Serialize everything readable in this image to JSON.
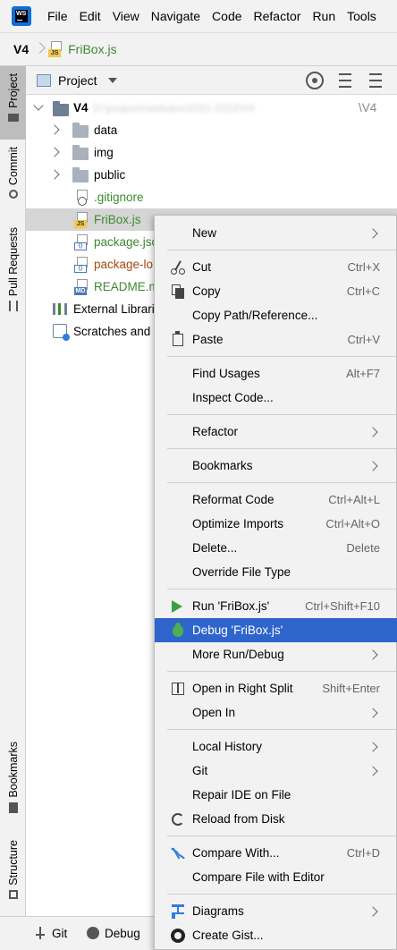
{
  "menubar": {
    "logo_text": "WS",
    "items": [
      "File",
      "Edit",
      "View",
      "Navigate",
      "Code",
      "Refactor",
      "Run",
      "Tools"
    ]
  },
  "breadcrumb": {
    "root": "V4",
    "file": "FriBox.js",
    "file_badge": "JS"
  },
  "left_stripe": {
    "tabs": [
      "Project",
      "Commit",
      "Pull Requests",
      "Bookmarks",
      "Structure"
    ]
  },
  "project_panel": {
    "title": "Project",
    "tree": {
      "root": {
        "name": "V4",
        "path_suffix": "\\V4",
        "path_blurred": "D:\\projects\\webdev\\2021-2022\\V4"
      },
      "items": [
        {
          "label": "data",
          "kind": "folder"
        },
        {
          "label": "img",
          "kind": "folder"
        },
        {
          "label": "public",
          "kind": "folder"
        },
        {
          "label": ".gitignore",
          "kind": "file",
          "badge": "",
          "color": "green"
        },
        {
          "label": "FriBox.js",
          "kind": "file",
          "badge": "JS",
          "color": "green"
        },
        {
          "label": "package.jso",
          "kind": "file",
          "badge": "{}",
          "color": "green"
        },
        {
          "label": "package-lo",
          "kind": "file",
          "badge": "{}",
          "color": "brown"
        },
        {
          "label": "README.m",
          "kind": "file",
          "badge": "MD",
          "color": "green"
        },
        {
          "label": "External Librari",
          "kind": "libs"
        },
        {
          "label": "Scratches and",
          "kind": "scratches"
        }
      ]
    }
  },
  "context_menu": {
    "items": [
      {
        "label": "New",
        "shortcut": "",
        "submenu": true
      },
      {
        "label": "Cut",
        "shortcut": "Ctrl+X"
      },
      {
        "label": "Copy",
        "shortcut": "Ctrl+C"
      },
      {
        "label": "Copy Path/Reference...",
        "shortcut": ""
      },
      {
        "label": "Paste",
        "shortcut": "Ctrl+V"
      },
      {
        "label": "Find Usages",
        "shortcut": "Alt+F7"
      },
      {
        "label": "Inspect Code...",
        "shortcut": ""
      },
      {
        "label": "Refactor",
        "shortcut": "",
        "submenu": true
      },
      {
        "label": "Bookmarks",
        "shortcut": "",
        "submenu": true
      },
      {
        "label": "Reformat Code",
        "shortcut": "Ctrl+Alt+L"
      },
      {
        "label": "Optimize Imports",
        "shortcut": "Ctrl+Alt+O"
      },
      {
        "label": "Delete...",
        "shortcut": "Delete"
      },
      {
        "label": "Override File Type",
        "shortcut": ""
      },
      {
        "label": "Run 'FriBox.js'",
        "shortcut": "Ctrl+Shift+F10"
      },
      {
        "label": "Debug 'FriBox.js'",
        "shortcut": "",
        "highlighted": true
      },
      {
        "label": "More Run/Debug",
        "shortcut": "",
        "submenu": true
      },
      {
        "label": "Open in Right Split",
        "shortcut": "Shift+Enter"
      },
      {
        "label": "Open In",
        "shortcut": "",
        "submenu": true
      },
      {
        "label": "Local History",
        "shortcut": "",
        "submenu": true
      },
      {
        "label": "Git",
        "shortcut": "",
        "submenu": true
      },
      {
        "label": "Repair IDE on File",
        "shortcut": ""
      },
      {
        "label": "Reload from Disk",
        "shortcut": ""
      },
      {
        "label": "Compare With...",
        "shortcut": "Ctrl+D"
      },
      {
        "label": "Compare File with Editor",
        "shortcut": ""
      },
      {
        "label": "Diagrams",
        "shortcut": "",
        "submenu": true
      },
      {
        "label": "Create Gist...",
        "shortcut": ""
      }
    ]
  },
  "bottom_bar": {
    "items": [
      "Git",
      "Debug"
    ]
  },
  "colors": {
    "highlight": "#2f65ca",
    "vcs_added": "#3c8a2e",
    "vcs_modified": "#a34a10",
    "run_green": "#3ea046"
  }
}
